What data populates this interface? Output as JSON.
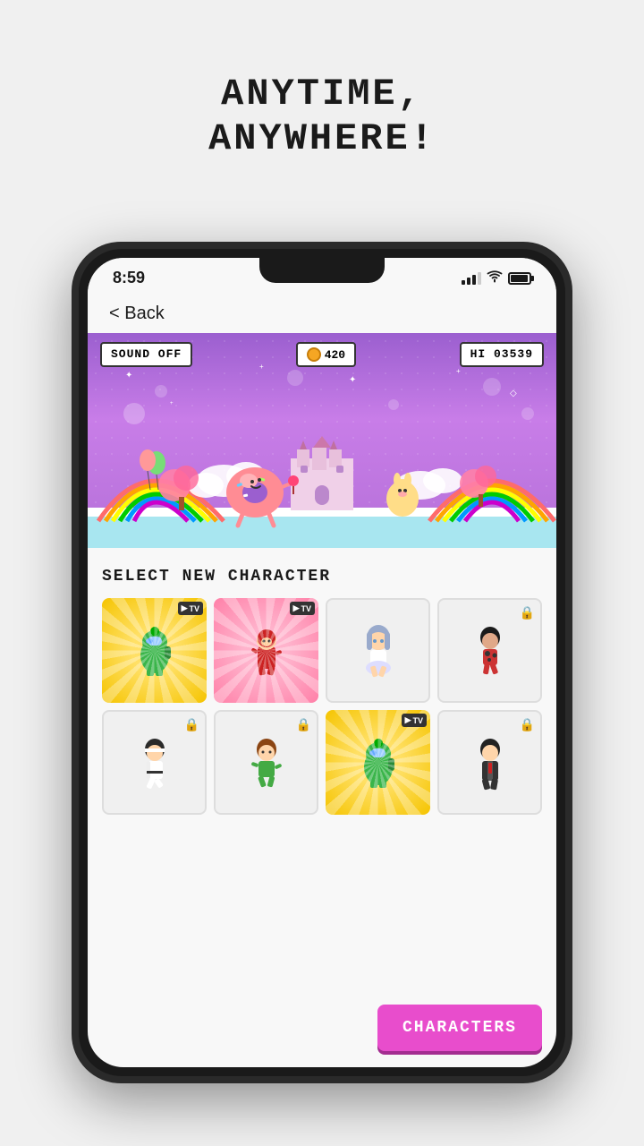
{
  "headline": {
    "line1": "ANYTIME,",
    "line2": "ANYWHERE!"
  },
  "status_bar": {
    "time": "8:59",
    "signal_level": 3,
    "battery_pct": 85
  },
  "back_button": "< Back",
  "game_hud": {
    "sound_btn": "SOUND OFF",
    "coins": "420",
    "hi_score_label": "HI",
    "hi_score": "03539"
  },
  "select_section": {
    "title": "SELECT NEW CHARACTER"
  },
  "characters": [
    {
      "id": 1,
      "bg": "gold",
      "locked": false,
      "tv_badge": true,
      "emoji": "🤖",
      "selected": true
    },
    {
      "id": 2,
      "bg": "pink",
      "locked": false,
      "tv_badge": true,
      "emoji": "🥷",
      "selected": false
    },
    {
      "id": 3,
      "bg": "white",
      "locked": false,
      "tv_badge": false,
      "emoji": "🧚",
      "selected": false
    },
    {
      "id": 4,
      "bg": "white",
      "locked": true,
      "tv_badge": false,
      "emoji": "💃",
      "selected": false
    },
    {
      "id": 5,
      "bg": "white",
      "locked": true,
      "tv_badge": false,
      "emoji": "🥋",
      "selected": false
    },
    {
      "id": 6,
      "bg": "white",
      "locked": true,
      "tv_badge": false,
      "emoji": "🧒",
      "selected": false
    },
    {
      "id": 7,
      "bg": "gold",
      "locked": false,
      "tv_badge": true,
      "emoji": "🤖",
      "selected": true
    },
    {
      "id": 8,
      "bg": "white",
      "locked": true,
      "tv_badge": false,
      "emoji": "🕴️",
      "selected": false
    }
  ],
  "characters_button": "CHARACTERS",
  "colors": {
    "accent_purple": "#9b5fcf",
    "accent_pink": "#e84dcc",
    "gold": "#f5c400",
    "pink_bg": "#ff80a8"
  }
}
